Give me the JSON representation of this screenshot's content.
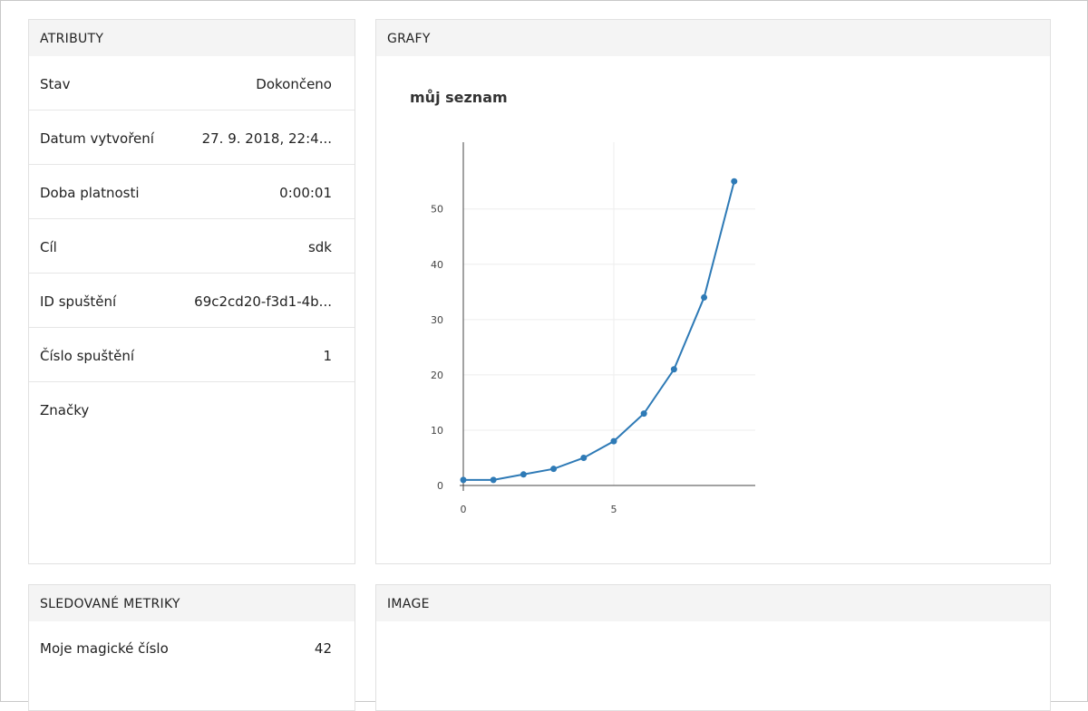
{
  "attributes": {
    "header": "ATRIBUTY",
    "rows": [
      {
        "label": "Stav",
        "value": "Dokončeno"
      },
      {
        "label": "Datum vytvoření",
        "value": "27. 9. 2018, 22:4..."
      },
      {
        "label": "Doba platnosti",
        "value": "0:00:01"
      },
      {
        "label": "Cíl",
        "value": "sdk"
      },
      {
        "label": "ID spuštění",
        "value": "69c2cd20-f3d1-4b..."
      },
      {
        "label": "Číslo spuštění",
        "value": "1"
      },
      {
        "label": "Značky",
        "value": ""
      }
    ]
  },
  "graphs": {
    "header": "GRAFY"
  },
  "metrics": {
    "header": "SLEDOVANÉ METRIKY",
    "rows": [
      {
        "label": "Moje magické číslo",
        "value": "42"
      }
    ]
  },
  "image": {
    "header": "IMAGE"
  },
  "chart_data": {
    "type": "line",
    "title": "můj seznam",
    "x": [
      0,
      1,
      2,
      3,
      4,
      5,
      6,
      7,
      8,
      9
    ],
    "series": [
      {
        "values": [
          1,
          1,
          2,
          3,
          5,
          8,
          13,
          21,
          34,
          55
        ],
        "color": "#2e7ab6"
      }
    ],
    "xticks": [
      0,
      5
    ],
    "yticks": [
      0,
      10,
      20,
      30,
      40,
      50
    ],
    "xlim": [
      0,
      9.7
    ],
    "ylim": [
      0,
      58.8
    ],
    "grid": true
  }
}
